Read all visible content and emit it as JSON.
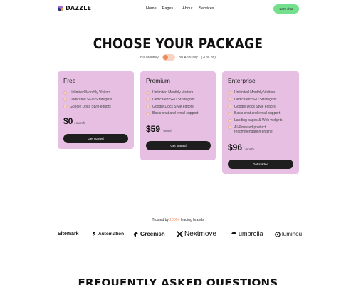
{
  "nav": {
    "logo_text": "DAZZLE",
    "links": [
      "Home",
      "Pages",
      "About",
      "Services"
    ],
    "cta_label": "Let's chat"
  },
  "pricing": {
    "title": "CHOOSE YOUR PACKAGE",
    "billing_monthly": "Bill Monthly",
    "billing_annually": "Bill Annually",
    "billing_discount": "(20% off)",
    "plans": [
      {
        "name": "Free",
        "features": [
          "Unlimited Monthly Visitors",
          "Dedicated SEO Strategists",
          "Google Docs Style editors"
        ],
        "price": "$0",
        "period": "/ month",
        "button": "Get started"
      },
      {
        "name": "Premium",
        "features": [
          "Unlimited Monthly Visitors",
          "Dedicated SEO Strategists",
          "Google Docs Style editors",
          "Basic chat and email support"
        ],
        "price": "$59",
        "period": "/ month",
        "button": "Get started"
      },
      {
        "name": "Enterprise",
        "features": [
          "Unlimited Monthly Visitors",
          "Dedicated SEO Strategists",
          "Google Docs Style editors",
          "Basic chat and email support",
          "Landing pages & Web widgets",
          "AI-Powered product",
          "recommendation engine"
        ],
        "price": "$96",
        "period": "/ month",
        "button": "Get started"
      }
    ]
  },
  "trusted": {
    "prefix": "Trusted by",
    "count": "1000+",
    "suffix": "leading brands"
  },
  "brands": [
    {
      "name": "Sitemark",
      "icon": "none"
    },
    {
      "name": "Automation",
      "icon": "automation-icon"
    },
    {
      "name": "Greenish",
      "icon": "greenish-icon"
    },
    {
      "name": "Nextmove",
      "icon": "nextmove-icon"
    },
    {
      "name": "umbrella",
      "icon": "umbrella-icon"
    },
    {
      "name": "luminou",
      "icon": "luminou-icon"
    }
  ],
  "faq": {
    "title": "FREQUENTLY ASKED QUESTIONS"
  },
  "colors": {
    "accent_green": "#74df8c",
    "card_pink": "#e6bfe3",
    "accent_orange": "#ec8a5c",
    "button_dark": "#1e1e1e"
  }
}
